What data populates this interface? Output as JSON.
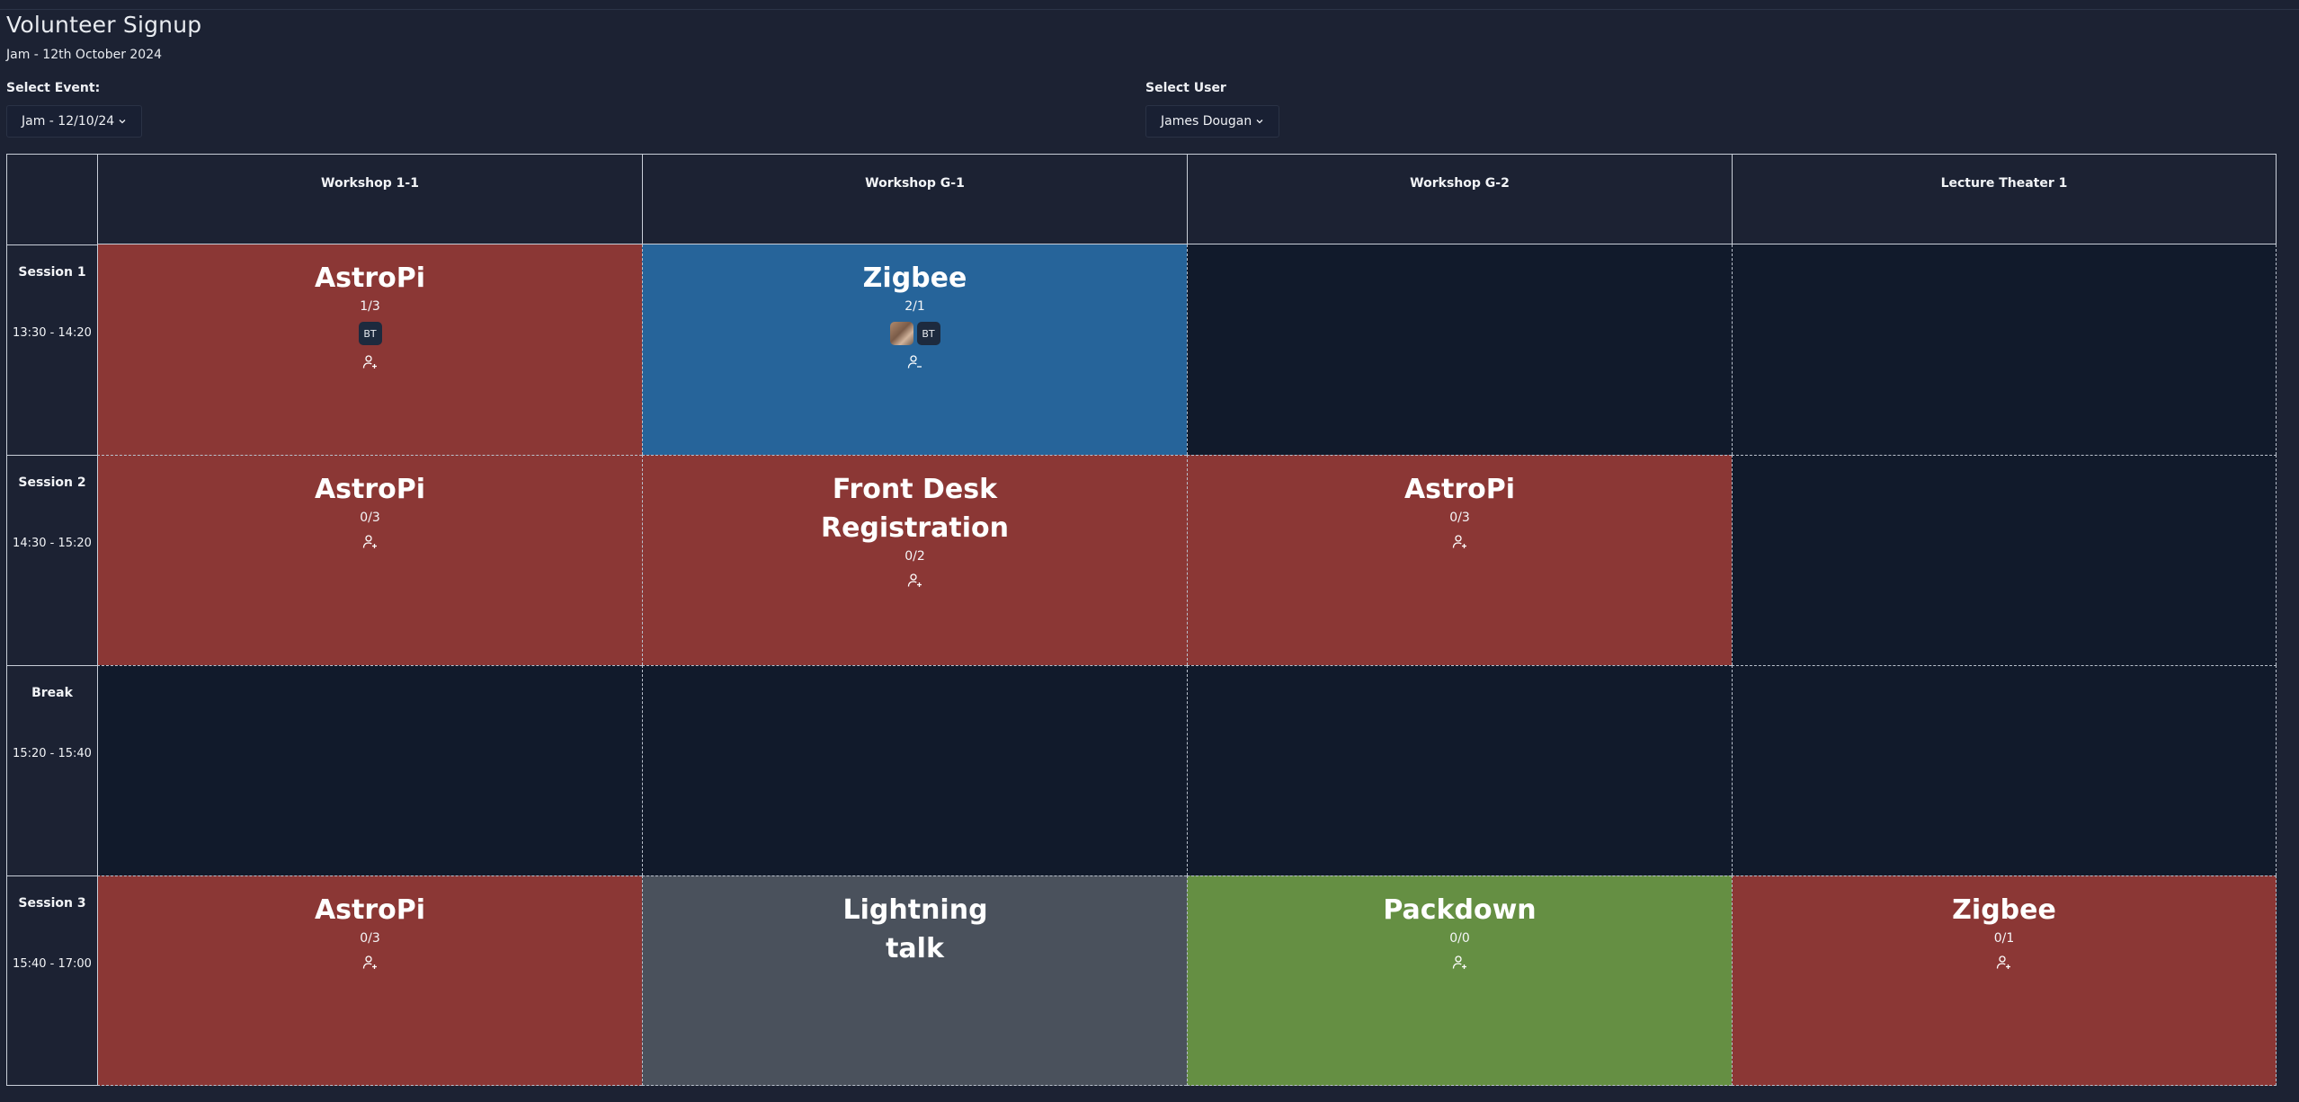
{
  "page": {
    "title": "Volunteer Signup",
    "subtitle": "Jam - 12th October 2024"
  },
  "event_select": {
    "label": "Select Event:",
    "value": "Jam - 12/10/24",
    "icon": "chevron-down-icon"
  },
  "user_select": {
    "label": "Select User",
    "value": "James Dougan",
    "icon": "chevron-down-icon"
  },
  "rooms": [
    "Workshop 1-1",
    "Workshop G-1",
    "Workshop G-2",
    "Lecture Theater 1"
  ],
  "sessions": [
    {
      "name": "Session 1",
      "time": "13:30 - 14:20"
    },
    {
      "name": "Session 2",
      "time": "14:30 - 15:20"
    },
    {
      "name": "Break",
      "time": "15:20 - 15:40"
    },
    {
      "name": "Session 3",
      "time": "15:40 - 17:00"
    }
  ],
  "slots": {
    "s1_w11": {
      "title": "AstroPi",
      "count": "1/3",
      "avatars": [
        "BT"
      ],
      "action": "add-volunteer-icon"
    },
    "s1_wg1": {
      "title": "Zigbee",
      "count": "2/1",
      "avatars": [
        "BT"
      ],
      "action": "remove-volunteer-icon"
    },
    "s2_w11": {
      "title": "AstroPi",
      "count": "0/3",
      "action": "add-volunteer-icon"
    },
    "s2_wg1": {
      "title": "Front Desk Registration",
      "count": "0/2",
      "action": "add-volunteer-icon"
    },
    "s2_wg2": {
      "title": "AstroPi",
      "count": "0/3",
      "action": "add-volunteer-icon"
    },
    "s3_w11": {
      "title": "AstroPi",
      "count": "0/3",
      "action": "add-volunteer-icon"
    },
    "s3_wg1": {
      "title": "Lightning talk"
    },
    "s3_wg2": {
      "title": "Packdown",
      "count": "0/0",
      "action": "add-volunteer-icon"
    },
    "s3_lt1": {
      "title": "Zigbee",
      "count": "0/1",
      "action": "add-volunteer-icon"
    }
  },
  "colors": {
    "background": "#1c2233",
    "empty_slot": "#111a2b",
    "understaffed": "#8b3735",
    "signed_up": "#26649a",
    "no_signup": "#4a515c",
    "full": "#658f43"
  }
}
